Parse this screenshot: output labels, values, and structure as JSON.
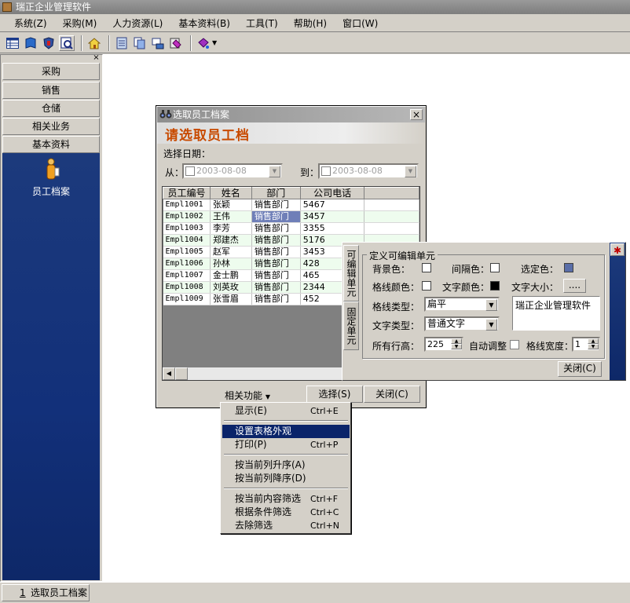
{
  "app": {
    "title": "瑞正企业管理软件"
  },
  "menubar": [
    "系统(Z)",
    "采购(M)",
    "人力资源(L)",
    "基本资料(B)",
    "工具(T)",
    "帮助(H)",
    "窗口(W)"
  ],
  "toolbar": {
    "icons": [
      "table-icon",
      "book-icon",
      "shield-icon",
      "search-icon",
      "home-icon",
      "document-icon",
      "copy-icon",
      "exchange-icon",
      "paint-icon"
    ]
  },
  "leftnav": {
    "items": [
      "采购",
      "销售",
      "仓储",
      "相关业务",
      "基本资料"
    ],
    "active_item": "员工档案"
  },
  "statusbar": {
    "tab_number": "1",
    "tab_label": "选取员工档案"
  },
  "dialog": {
    "title": "选取员工档案",
    "heading": "请选取员工档",
    "date_label": "选择日期：",
    "from_label": "从：",
    "to_label": "到：",
    "from_date": "2003-08-08",
    "to_date": "2003-08-08",
    "columns": [
      "员工编号",
      "姓名",
      "部门",
      "公司电话"
    ],
    "rows": [
      [
        "Empl1001",
        "张颖",
        "销售部门",
        "5467"
      ],
      [
        "Empl1002",
        "王伟",
        "销售部门",
        "3457"
      ],
      [
        "Empl1003",
        "李芳",
        "销售部门",
        "3355"
      ],
      [
        "Empl1004",
        "郑建杰",
        "销售部门",
        "5176"
      ],
      [
        "Empl1005",
        "赵军",
        "销售部门",
        "3453"
      ],
      [
        "Empl1006",
        "孙林",
        "销售部门",
        "428"
      ],
      [
        "Empl1007",
        "金士鹏",
        "销售部门",
        "465"
      ],
      [
        "Empl1008",
        "刘英玫",
        "销售部门",
        "2344"
      ],
      [
        "Empl1009",
        "张雪眉",
        "销售部门",
        "452"
      ]
    ],
    "related_label": "相关功能",
    "select_label": "选择(S)",
    "close_label": "关闭(C)"
  },
  "context_menu": {
    "items": [
      {
        "label": "显示(E)",
        "shortcut": "Ctrl+E"
      },
      {
        "label": "设置表格外观",
        "shortcut": ""
      },
      {
        "label": "打印(P)",
        "shortcut": "Ctrl+P"
      },
      {
        "label": "按当前列升序(A)",
        "shortcut": ""
      },
      {
        "label": "按当前列降序(D)",
        "shortcut": ""
      },
      {
        "label": "按当前内容筛选",
        "shortcut": "Ctrl+F"
      },
      {
        "label": "根据条件筛选",
        "shortcut": "Ctrl+C"
      },
      {
        "label": "去除筛选",
        "shortcut": "Ctrl+N"
      }
    ],
    "highlighted": "设置表格外观"
  },
  "props": {
    "tab_editable": "可编辑单元",
    "tab_fixed": "固定单元",
    "group_title": "定义可编辑单元",
    "bg_color_label": "背景色：",
    "interval_color_label": "间隔色：",
    "selected_color_label": "选定色：",
    "gridline_color_label": "格线颜色：",
    "text_color_label": "文字颜色：",
    "text_size_label": "文字大小：",
    "text_size_button": "....",
    "gridline_type_label": "格线类型：",
    "gridline_type_value": "扁平",
    "text_type_label": "文字类型：",
    "text_type_value": "普通文字",
    "row_height_label": "所有行高：",
    "row_height_value": "225",
    "auto_adjust_label": "自动调整",
    "gridline_width_label": "格线宽度：",
    "gridline_width_value": "1",
    "preview_text": "瑞正企业管理软件",
    "close_label": "关闭(C)",
    "colors": {
      "selected": "#5a6ea8",
      "text": "#000000",
      "bg": "#ffffff"
    }
  }
}
